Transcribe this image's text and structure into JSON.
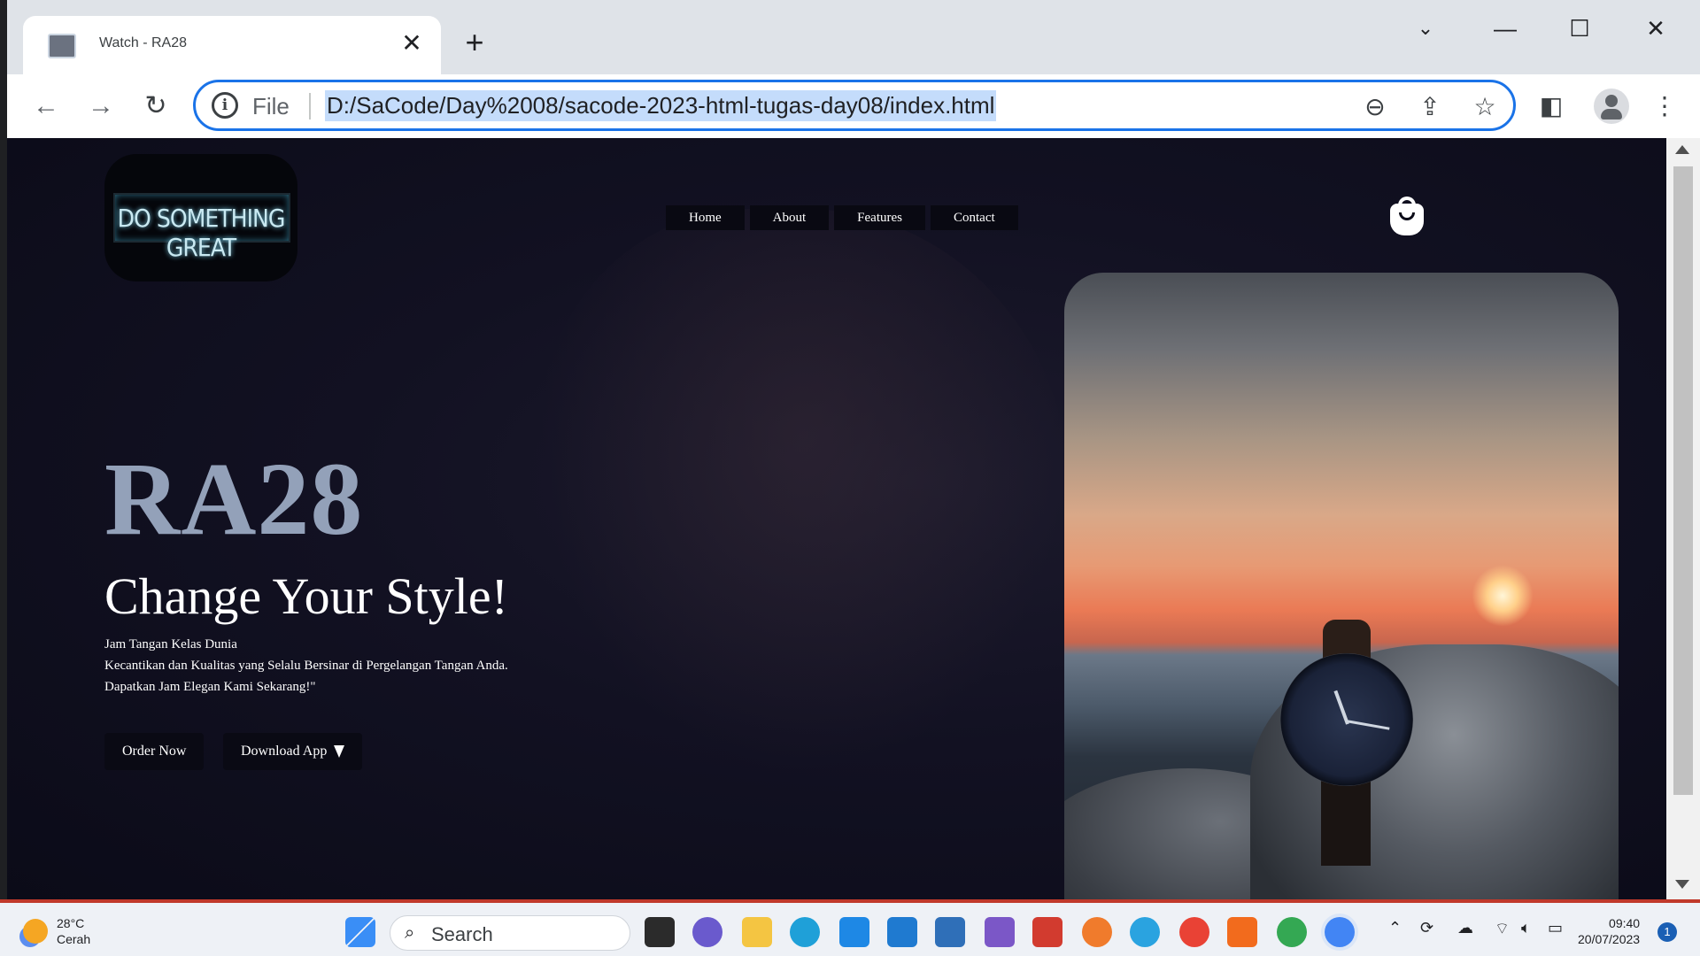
{
  "browser": {
    "tab_title": "Watch - RA28",
    "new_tab_symbol": "+",
    "url_scheme": "File",
    "url": "D:/SaCode/Day%2008/sacode-2023-html-tugas-day08/index.html"
  },
  "page": {
    "logo_text": "DO SOMETHING GREAT",
    "nav": [
      "Home",
      "About",
      "Features",
      "Contact"
    ],
    "hero_title": "RA28",
    "hero_subtitle": "Change Your Style!",
    "description_lines": [
      "Jam Tangan Kelas Dunia",
      "Kecantikan dan Kualitas yang Selalu Bersinar di Pergelangan Tangan Anda.",
      "Dapatkan Jam Elegan Kami Sekarang!\""
    ],
    "buttons": {
      "order": "Order Now",
      "download": "Download App"
    }
  },
  "taskbar": {
    "weather_temp": "28°C",
    "weather_desc": "Cerah",
    "search_label": "Search",
    "time": "09:40",
    "date": "20/07/2023",
    "notification_count": "1"
  },
  "colors": {
    "accent": "#1a73e8",
    "hero_title": "#93a1b9",
    "page_bg": "#121122"
  }
}
